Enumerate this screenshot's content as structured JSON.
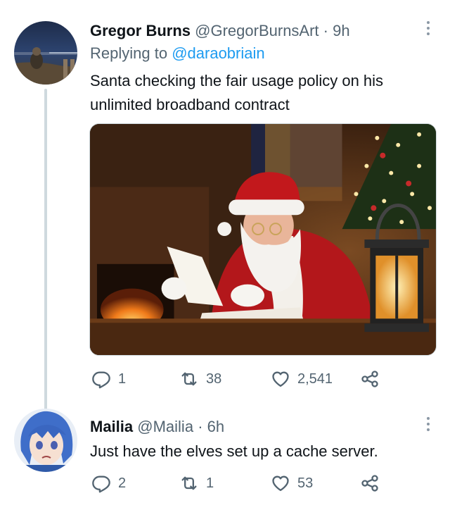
{
  "tweets": [
    {
      "display_name": "Gregor Burns",
      "handle": "@GregorBurnsArt",
      "separator": "·",
      "time": "9h",
      "replying_prefix": "Replying to",
      "replying_to": "@daraobriain",
      "text": "Santa checking the fair usage policy on his unlimited broadband contract",
      "reply_count": "1",
      "retweet_count": "38",
      "like_count": "2,541"
    },
    {
      "display_name": "Mailia",
      "handle": "@Mailia",
      "separator": "·",
      "time": "6h",
      "text": "Just have the elves set up a cache server.",
      "reply_count": "2",
      "retweet_count": "1",
      "like_count": "53"
    }
  ],
  "colors": {
    "text": "#0f1419",
    "secondary": "#536471",
    "link": "#1d9bf0",
    "thread_line": "#cfd9de"
  },
  "icons": {
    "reply": "reply-icon",
    "retweet": "retweet-icon",
    "like": "heart-icon",
    "share": "share-icon",
    "more": "more-icon"
  }
}
